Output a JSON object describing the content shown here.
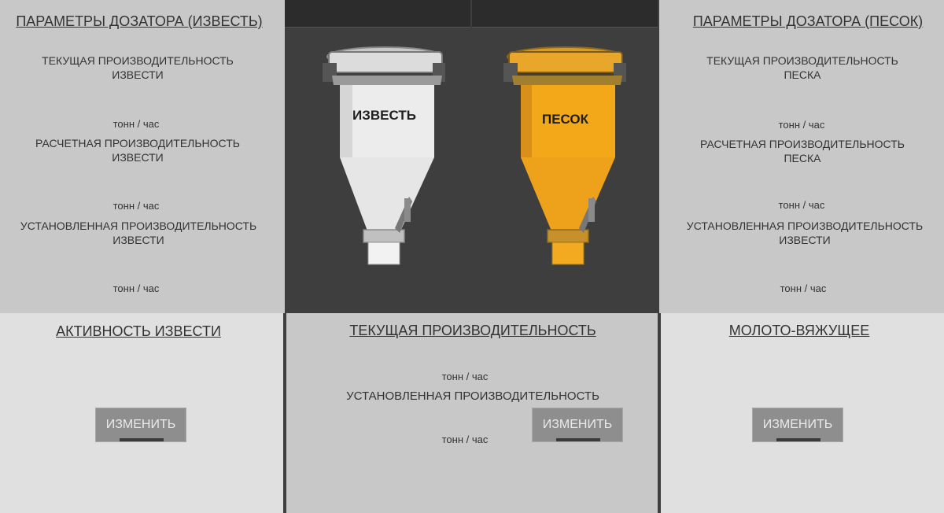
{
  "left_panel": {
    "title": "ПАРАМЕТРЫ ДОЗАТОРА (ИЗВЕСТЬ)",
    "current_label": "ТЕКУЩАЯ ПРОИЗВОДИТЕЛЬНОСТЬ\nИЗВЕСТИ",
    "current_unit": "тонн / час",
    "calc_label": "РАСЧЕТНАЯ ПРОИЗВОДИТЕЛЬНОСТЬ\nИЗВЕСТИ",
    "calc_unit": "тонн / час",
    "set_label": "УСТАНОВЛЕННАЯ ПРОИЗВОДИТЕЛЬНОСТЬ\nИЗВЕСТИ",
    "set_unit": "тонн / час"
  },
  "right_panel": {
    "title": "ПАРАМЕТРЫ ДОЗАТОРА (ПЕСОК)",
    "current_label": "ТЕКУЩАЯ ПРОИЗВОДИТЕЛЬНОСТЬ\nПЕСКА",
    "current_unit": "тонн / час",
    "calc_label": "РАСЧЕТНАЯ ПРОИЗВОДИТЕЛЬНОСТЬ\nПЕСКА",
    "calc_unit": "тонн / час",
    "set_label": "УСТАНОВЛЕННАЯ ПРОИЗВОДИТЕЛЬНОСТЬ\nИЗВЕСТИ",
    "set_unit": "тонн / час"
  },
  "hoppers": {
    "lime_label": "ИЗВЕСТЬ",
    "lime_color": "#ececec",
    "sand_label": "ПЕСОК",
    "sand_color": "#f0a818"
  },
  "activity": {
    "title": "АКТИВНОСТЬ ИЗВЕСТИ",
    "button_label": "ИЗМЕНИТЬ"
  },
  "current_perf": {
    "title": "ТЕКУЩАЯ ПРОИЗВОДИТЕЛЬНОСТЬ",
    "unit": "тонн / час",
    "set_label": "УСТАНОВЛЕННАЯ ПРОИЗВОДИТЕЛЬНОСТЬ",
    "set_unit": "тонн / час",
    "button_label": "ИЗМЕНИТЬ"
  },
  "binder": {
    "title": "МОЛОТО-ВЯЖУЩЕЕ",
    "button_label": "ИЗМЕНИТЬ"
  }
}
